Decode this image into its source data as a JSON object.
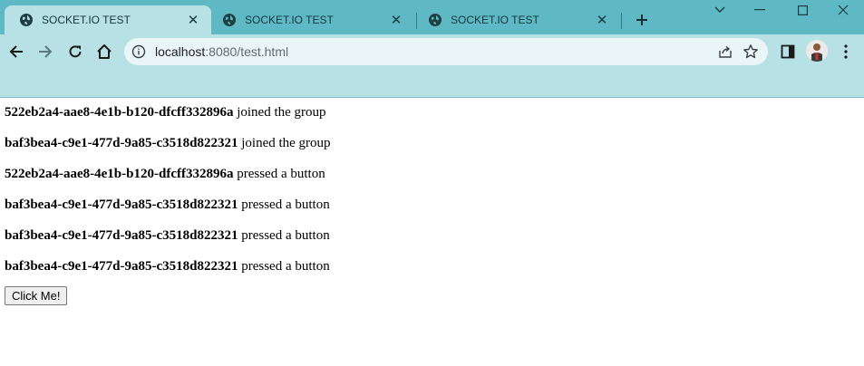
{
  "browser": {
    "tabs": [
      {
        "title": "SOCKET.IO TEST",
        "icon": "globe-icon",
        "active": true
      },
      {
        "title": "SOCKET.IO TEST",
        "icon": "globe-icon",
        "active": false
      },
      {
        "title": "SOCKET.IO TEST",
        "icon": "globe-icon",
        "active": false
      }
    ],
    "address": {
      "host": "localhost",
      "path": ":8080/test.html"
    },
    "colors": {
      "tabstrip": "#5fb9c4",
      "toolbar": "#b7e1e5",
      "omnibox": "#e9f5f6"
    }
  },
  "page": {
    "messages": [
      {
        "user": "522eb2a4-aae8-4e1b-b120-dfcff332896a",
        "action": "joined the group"
      },
      {
        "user": "baf3bea4-c9e1-477d-9a85-c3518d822321",
        "action": "joined the group"
      },
      {
        "user": "522eb2a4-aae8-4e1b-b120-dfcff332896a",
        "action": "pressed a button"
      },
      {
        "user": "baf3bea4-c9e1-477d-9a85-c3518d822321",
        "action": "pressed a button"
      },
      {
        "user": "baf3bea4-c9e1-477d-9a85-c3518d822321",
        "action": "pressed a button"
      },
      {
        "user": "baf3bea4-c9e1-477d-9a85-c3518d822321",
        "action": "pressed a button"
      }
    ],
    "button_label": "Click Me!"
  }
}
